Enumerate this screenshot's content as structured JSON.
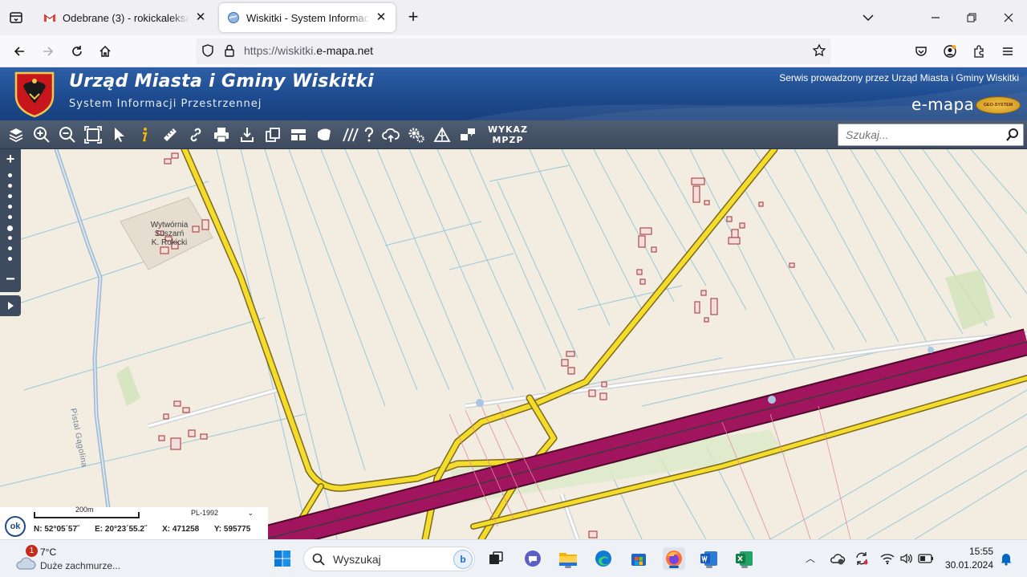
{
  "browser": {
    "tabs": [
      {
        "title": "Odebrane (3) - rokickaleksandra",
        "favicon": "gmail-icon",
        "active": false
      },
      {
        "title": "Wiskitki - System Informacji Przestrzennej",
        "favicon": "emapa-globe-icon",
        "active": true
      }
    ],
    "url_prefix": "https://wiskitki.",
    "url_domain": "e-mapa.net"
  },
  "site": {
    "title": "Urząd Miasta i Gminy Wiskitki",
    "subtitle": "System Informacji Przestrzennej",
    "service_text": "Serwis prowadzony przez Urząd Miasta i Gminy Wiskitki",
    "brand": "e-mapa",
    "brand_badge": "GEO-SYSTEM",
    "colors": {
      "header": "#1e4b8f",
      "toolbar": "#3e4a5d",
      "highway": "#a0155e",
      "road": "#f5dc2b"
    }
  },
  "toolbar": {
    "tools": [
      "layers-icon",
      "zoom-in-icon",
      "zoom-out-icon",
      "full-extent-icon",
      "select-arrow-icon",
      "info-icon",
      "measure-ruler-icon",
      "link-icon",
      "print-icon",
      "download-icon",
      "copy-icon",
      "layout-icon",
      "shape-icon",
      "hatch-icon",
      "help-icon",
      "cloud-upload-icon",
      "settings-icon",
      "terrain-icon",
      "chat-icon"
    ],
    "wykaz_line1": "WYKAZ",
    "wykaz_line2": "MPZP",
    "search_placeholder": "Szukaj..."
  },
  "map": {
    "labels": {
      "factory_line1": "Wytwórnia",
      "factory_line2": "Suszarń",
      "factory_line3": "K. Rokicki",
      "road_name": "Pistal Gągolina"
    },
    "status": {
      "ok_label": "ok",
      "scale_label": "200m",
      "crs": "PL-1992",
      "lat": "N: 52°05´57˝",
      "lon": "E: 20°23´55.2˝",
      "x": "X: 471258",
      "y": "Y: 595775"
    }
  },
  "taskbar": {
    "weather_temp": "7°C",
    "weather_desc": "Duże zachmurze...",
    "weather_badge": "1",
    "search_label": "Wyszukaj",
    "bing_label": "b",
    "time": "15:55",
    "date": "30.01.2024"
  }
}
